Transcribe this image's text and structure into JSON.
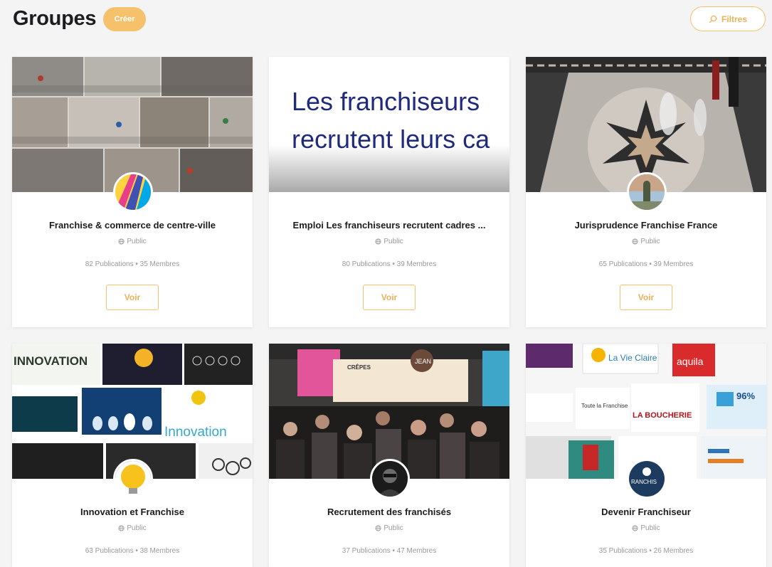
{
  "header": {
    "title": "Groupes",
    "create_label": "Créer",
    "filters_label": "Filtres"
  },
  "colors": {
    "accent": "#f5c26b",
    "accent_text": "#e9b25a"
  },
  "groups": [
    {
      "name": "Franchise & commerce de centre-ville",
      "visibility": "Public",
      "publications": "82 Publications",
      "members": "35 Membres",
      "view_label": "Voir"
    },
    {
      "name": "Emploi Les franchiseurs recrutent cadres ...",
      "visibility": "Public",
      "publications": "80 Publications",
      "members": "39 Membres",
      "view_label": "Voir",
      "cover_text_line1": "Les franchiseurs",
      "cover_text_line2": "recrutent leurs ca"
    },
    {
      "name": "Jurisprudence Franchise France",
      "visibility": "Public",
      "publications": "65 Publications",
      "members": "39 Membres",
      "view_label": "Voir"
    },
    {
      "name": "Innovation et Franchise",
      "visibility": "Public",
      "publications": "63 Publications",
      "members": "38 Membres",
      "cover_text_1": "INNOVATION",
      "cover_text_2": "Innovation"
    },
    {
      "name": "Recrutement des franchisés",
      "visibility": "Public",
      "publications": "37 Publications",
      "members": "47 Membres",
      "cover_text_1": "CRÊPES",
      "cover_text_2": "JEAN"
    },
    {
      "name": "Devenir Franchiseur",
      "visibility": "Public",
      "publications": "35 Publications",
      "members": "26 Membres",
      "cover_text_1": "La Vie Claire",
      "cover_text_2": "aquila",
      "cover_text_3": "LA BOUCHERIE",
      "cover_text_4": "Toute la Franchise",
      "cover_text_5": "96%"
    }
  ]
}
